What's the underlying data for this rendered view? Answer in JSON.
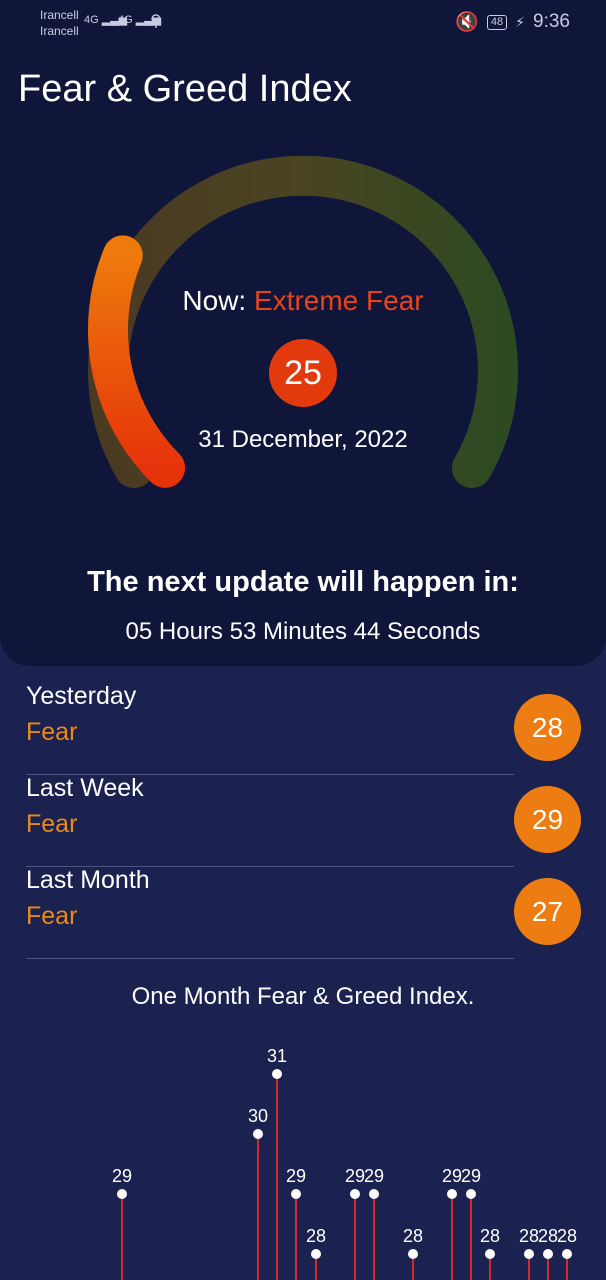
{
  "status_bar": {
    "carrier_1": "Irancell",
    "carrier_2": "Irancell",
    "net_1": "4G",
    "net_2": "4G",
    "battery": "48",
    "time": "9:36"
  },
  "header": {
    "title": "Fear & Greed Index"
  },
  "gauge": {
    "now_label": "Now:",
    "status": "Extreme Fear",
    "value": "25",
    "date": "31 December, 2022",
    "fraction": 0.25
  },
  "update": {
    "title": "The next update will happen in:",
    "countdown": "05 Hours 53 Minutes 44 Seconds"
  },
  "history": [
    {
      "label": "Yesterday",
      "status": "Fear",
      "value": "28"
    },
    {
      "label": "Last Week",
      "status": "Fear",
      "value": "29"
    },
    {
      "label": "Last Month",
      "status": "Fear",
      "value": "27"
    }
  ],
  "chart_data": {
    "type": "scatter",
    "title": "One Month Fear & Greed Index.",
    "values": [
      29,
      30,
      31,
      29,
      28,
      29,
      29,
      28,
      29,
      29,
      28,
      28,
      28,
      28
    ],
    "point_color": "#ffffff",
    "stem_color": "#d42a2a"
  },
  "colors": {
    "background": "#1b2250",
    "panel": "#10163a",
    "extreme_fear": "#e23a0c",
    "fear": "#ed7d12",
    "greed": "#2e4a22"
  }
}
